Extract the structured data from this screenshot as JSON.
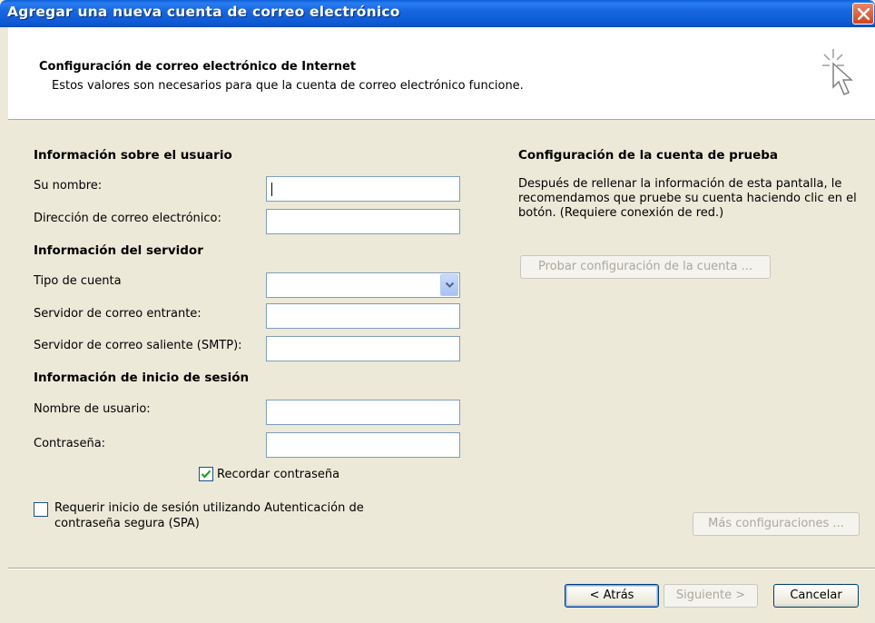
{
  "window": {
    "title": "Agregar una nueva cuenta de correo electrónico"
  },
  "header": {
    "title": "Configuración de correo electrónico de Internet",
    "subtitle": "Estos valores son necesarios para que la cuenta de correo electrónico funcione."
  },
  "user_info": {
    "section_title": "Información sobre el usuario",
    "name_label": "Su nombre:",
    "name_value": "",
    "email_label": "Dirección de correo electrónico:",
    "email_value": ""
  },
  "server_info": {
    "section_title": "Información del servidor",
    "account_type_label": "Tipo de cuenta",
    "account_type_value": "",
    "incoming_label": "Servidor de correo entrante:",
    "incoming_value": "",
    "outgoing_label": "Servidor de correo saliente (SMTP):",
    "outgoing_value": ""
  },
  "login_info": {
    "section_title": "Información de inicio de sesión",
    "username_label": "Nombre de usuario:",
    "username_value": "",
    "password_label": "Contraseña:",
    "password_value": "",
    "remember_label": "Recordar contraseña",
    "remember_checked": true,
    "spa_label_line1": "Requerir inicio de sesión utilizando Autenticación de",
    "spa_label_line2": "contraseña segura (SPA)",
    "spa_checked": false
  },
  "test_settings": {
    "section_title": "Configuración de la cuenta de prueba",
    "description": "Después de rellenar la información de esta pantalla, le recomendamos que pruebe su cuenta haciendo clic en el botón. (Requiere conexión de red.)",
    "test_button": "Probar configuración de la cuenta ..."
  },
  "more_settings_button": "Más configuraciones ...",
  "footer": {
    "back": "< Atrás",
    "next": "Siguiente >",
    "cancel": "Cancelar"
  },
  "colors": {
    "titlebar": "#1667e0",
    "dialog_bg": "#ece9d8",
    "checkmark": "#21a121"
  },
  "icons": [
    "close-icon",
    "wizard-cursor-icon",
    "chevron-down-icon",
    "checkmark-icon"
  ]
}
